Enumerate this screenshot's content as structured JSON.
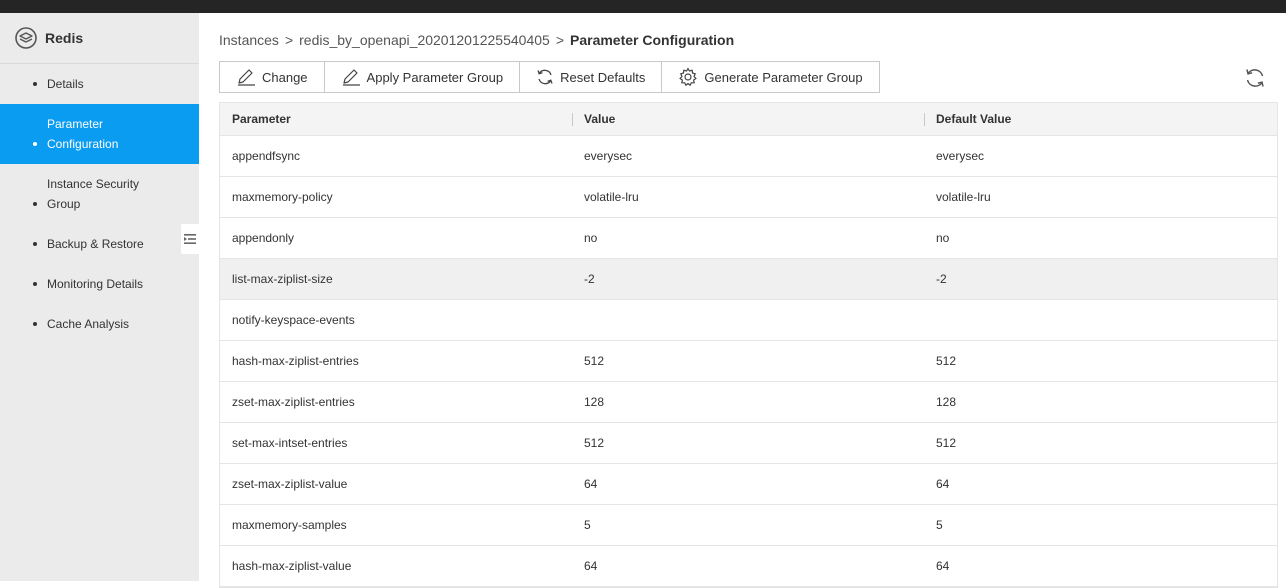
{
  "sidebar": {
    "brand": "Redis",
    "items": [
      {
        "id": "details",
        "lines": [
          "Details"
        ],
        "active": false
      },
      {
        "id": "parameter-configuration",
        "lines": [
          "Parameter",
          "Configuration"
        ],
        "active": true
      },
      {
        "id": "instance-security-group",
        "lines": [
          "Instance Security",
          "Group"
        ],
        "active": false
      },
      {
        "id": "backup-restore",
        "lines": [
          "Backup & Restore"
        ],
        "active": false
      },
      {
        "id": "monitoring-details",
        "lines": [
          "Monitoring Details"
        ],
        "active": false
      },
      {
        "id": "cache-analysis",
        "lines": [
          "Cache Analysis"
        ],
        "active": false
      }
    ]
  },
  "breadcrumb": {
    "root": "Instances",
    "separator": ">",
    "instance": "redis_by_openapi_20201201225540405",
    "current": "Parameter Configuration"
  },
  "toolbar": {
    "change": "Change",
    "apply_group": "Apply Parameter Group",
    "reset": "Reset Defaults",
    "generate_group": "Generate Parameter Group"
  },
  "table": {
    "headers": [
      "Parameter",
      "Value",
      "Default Value"
    ],
    "rows": [
      [
        "appendfsync",
        "everysec",
        "everysec"
      ],
      [
        "maxmemory-policy",
        "volatile-lru",
        "volatile-lru"
      ],
      [
        "appendonly",
        "no",
        "no"
      ],
      [
        "list-max-ziplist-size",
        "-2",
        "-2"
      ],
      [
        "notify-keyspace-events",
        "",
        ""
      ],
      [
        "hash-max-ziplist-entries",
        "512",
        "512"
      ],
      [
        "zset-max-ziplist-entries",
        "128",
        "128"
      ],
      [
        "set-max-intset-entries",
        "512",
        "512"
      ],
      [
        "zset-max-ziplist-value",
        "64",
        "64"
      ],
      [
        "maxmemory-samples",
        "5",
        "5"
      ],
      [
        "hash-max-ziplist-value",
        "64",
        "64"
      ]
    ],
    "hover_row": 3
  },
  "colors": {
    "accent": "#0a9cf0",
    "sidebar_bg": "#ebebeb",
    "topbar": "#252525"
  }
}
